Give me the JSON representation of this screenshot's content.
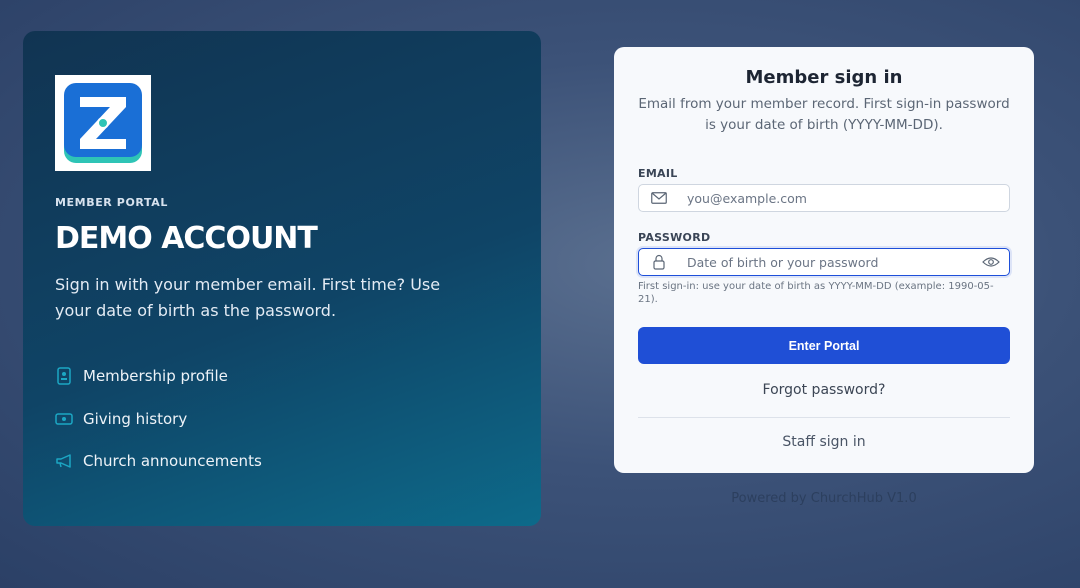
{
  "hero": {
    "eyebrow": "MEMBER PORTAL",
    "title": "DEMO ACCOUNT",
    "description": "Sign in with your member email. First time? Use your date of birth as the password.",
    "features": [
      {
        "icon": "id-badge-icon",
        "label": "Membership profile"
      },
      {
        "icon": "money-icon",
        "label": "Giving history"
      },
      {
        "icon": "megaphone-icon",
        "label": "Church announcements"
      }
    ]
  },
  "card": {
    "title": "Member sign in",
    "subtitle": "Email from your member record. First sign-in password is your date of birth (YYYY-MM-DD).",
    "email": {
      "label": "EMAIL",
      "placeholder": "you@example.com",
      "value": ""
    },
    "password": {
      "label": "PASSWORD",
      "placeholder": "Date of birth or your password",
      "value": ""
    },
    "hint": "First sign-in: use your date of birth as YYYY-MM-DD (example: 1990-05-21).",
    "submit_label": "Enter Portal",
    "forgot_label": "Forgot password?",
    "staff_label": "Staff sign in"
  },
  "footer": {
    "powered": "Powered by ChurchHub V1.0"
  },
  "colors": {
    "accent": "#1f4fd6",
    "hero_start": "#113452",
    "hero_end": "#0d6a8a",
    "logo_blue": "#1a73d9",
    "logo_teal": "#2ec4b6"
  }
}
